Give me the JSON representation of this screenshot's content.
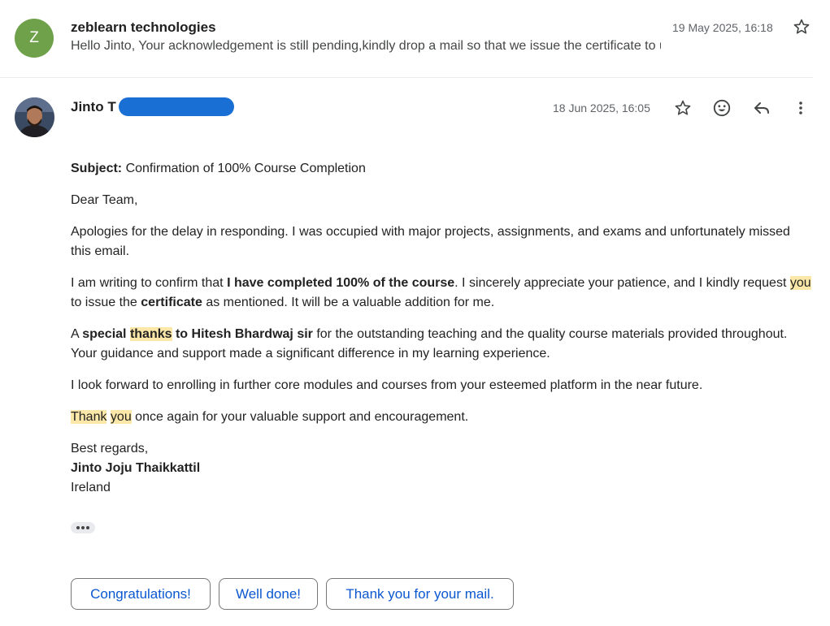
{
  "previous_message": {
    "avatar_letter": "Z",
    "sender": "zeblearn technologies",
    "snippet": "Hello Jinto, Your acknowledgement is still pending,kindly drop a mail so that we issue the certificate to u",
    "date": "19 May 2025, 16:18"
  },
  "message": {
    "sender": "Jinto T",
    "date": "18 Jun 2025, 16:05",
    "subject_label": "Subject:",
    "subject": "Confirmation of 100% Course Completion",
    "greeting": "Dear Team,",
    "para1": "Apologies for the delay in responding. I was occupied with major projects, assignments, and exams and unfortunately missed this email.",
    "para2": {
      "t1": "I am writing to confirm that ",
      "b1": "I have completed 100% of the course",
      "t2": ". I sincerely appreciate your patience, and I kindly request ",
      "h1": "you",
      "t3": " to issue the ",
      "b2": "certificate",
      "t4": " as mentioned. It will be a valuable addition for me."
    },
    "para3": {
      "t1": "A ",
      "b1": "special ",
      "h1": "thanks",
      "b2": " to Hitesh Bhardwaj sir",
      "t2": " for the outstanding teaching and the quality course materials provided throughout. Your guidance and support made a significant difference in my learning experience."
    },
    "para4": "I look forward to enrolling in further core modules and courses from your esteemed platform in the near future.",
    "para5": {
      "h1": "Thank",
      "t1": " ",
      "h2": "you",
      "t2": " once again for your valuable support and encouragement."
    },
    "closing": "Best regards,",
    "signature_name": "Jinto Joju Thaikkattil",
    "signature_location": "Ireland"
  },
  "smart_replies": [
    "Congratulations!",
    "Well done!",
    "Thank you for your mail."
  ],
  "colors": {
    "avatar_green": "#6fa04a",
    "highlight": "#fbe7a8",
    "chip_text": "#0b57d0"
  },
  "icons": [
    "star-icon",
    "emoji-icon",
    "reply-icon",
    "more-vert-icon"
  ]
}
